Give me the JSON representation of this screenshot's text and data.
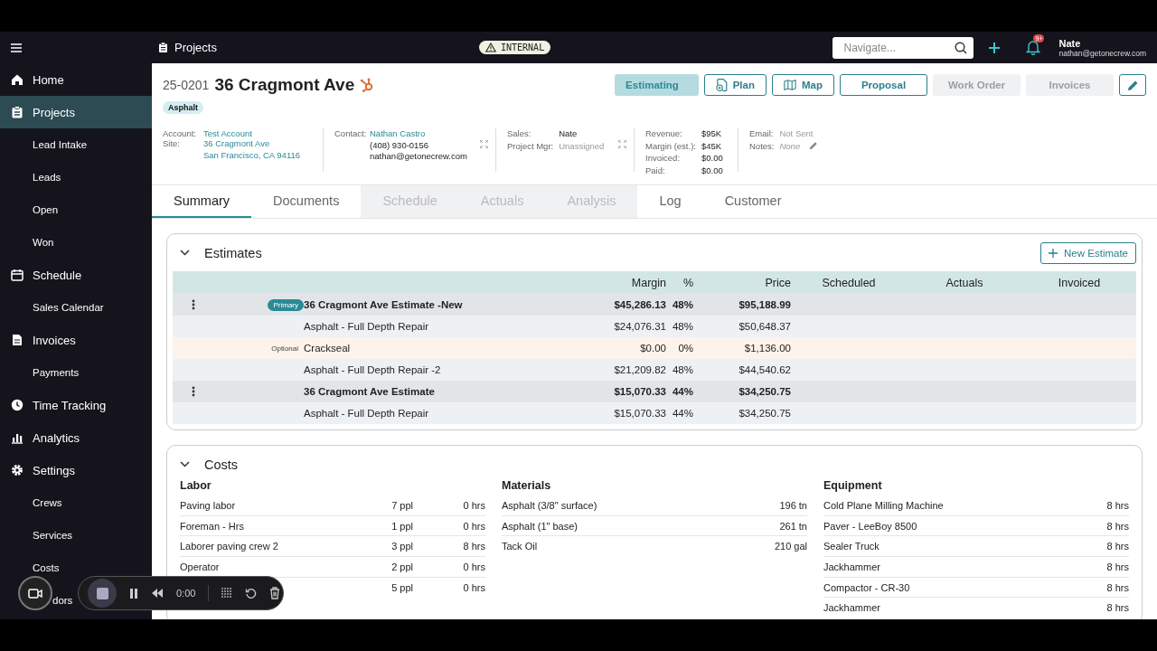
{
  "topbar": {
    "section": "Projects",
    "badge": "INTERNAL",
    "search": {
      "placeholder": "Navigate..."
    },
    "notifications": "9+",
    "user": {
      "name": "Nate",
      "email": "nathan@getonecrew.com"
    }
  },
  "sidebar": {
    "items": [
      {
        "kind": "main",
        "label": "Home",
        "selected": false
      },
      {
        "kind": "main",
        "label": "Projects",
        "selected": true
      },
      {
        "kind": "sub",
        "label": "Lead Intake",
        "selected": false
      },
      {
        "kind": "sub",
        "label": "Leads",
        "selected": false
      },
      {
        "kind": "sub",
        "label": "Open",
        "selected": false
      },
      {
        "kind": "sub",
        "label": "Won",
        "selected": false
      },
      {
        "kind": "main",
        "label": "Schedule",
        "selected": false
      },
      {
        "kind": "sub",
        "label": "Sales Calendar",
        "selected": false
      },
      {
        "kind": "main",
        "label": "Invoices",
        "selected": false
      },
      {
        "kind": "sub",
        "label": "Payments",
        "selected": false
      },
      {
        "kind": "main",
        "label": "Time Tracking",
        "selected": false
      },
      {
        "kind": "main",
        "label": "Analytics",
        "selected": false
      },
      {
        "kind": "main",
        "label": "Settings",
        "selected": false
      },
      {
        "kind": "sub",
        "label": "Crews",
        "selected": false
      },
      {
        "kind": "sub",
        "label": "Services",
        "selected": false
      },
      {
        "kind": "sub",
        "label": "Costs",
        "selected": false
      },
      {
        "kind": "sub",
        "label": "dors",
        "selected": false
      }
    ]
  },
  "project": {
    "number": "25-0201",
    "title": "36 Cragmont Ave",
    "tag": "Asphalt",
    "actions": [
      {
        "kind": "status",
        "label": "Estimating",
        "disabled": false
      },
      {
        "kind": "plan",
        "label": "Plan",
        "disabled": false
      },
      {
        "kind": "map",
        "label": "Map",
        "disabled": false
      },
      {
        "kind": "plain",
        "label": "Proposal",
        "disabled": false
      },
      {
        "kind": "plain",
        "label": "Work Order",
        "disabled": true
      },
      {
        "kind": "plain",
        "label": "Invoices",
        "disabled": true
      },
      {
        "kind": "edit",
        "disabled": false
      }
    ],
    "account": {
      "account_label": "Account:",
      "account": "Test Account",
      "site_label": "Site:",
      "site_line1": "36 Cragmont Ave",
      "site_line2": "San Francisco, CA 94116"
    },
    "contact": {
      "label": "Contact:",
      "name": "Nathan Castro",
      "phone": "(408) 930-0156",
      "email": "nathan@getonecrew.com"
    },
    "people": [
      {
        "label": "Sales:",
        "value": "Nate",
        "unset": false
      },
      {
        "label": "Project Mgr:",
        "value": "Unassigned",
        "unset": true
      }
    ],
    "money": [
      {
        "label": "Revenue:",
        "value": "$95K"
      },
      {
        "label": "Margin (est.):",
        "value": "$45K"
      },
      {
        "label": "Invoiced:",
        "value": "$0.00"
      },
      {
        "label": "Paid:",
        "value": "$0.00"
      }
    ],
    "email_label": "Email:",
    "email_status": "Not Sent",
    "notes_label": "Notes:",
    "notes": "None"
  },
  "tabs": [
    {
      "label": "Summary",
      "selected": true,
      "disabled": false
    },
    {
      "label": "Documents",
      "selected": false,
      "disabled": false
    },
    {
      "label": "Schedule",
      "selected": false,
      "disabled": true
    },
    {
      "label": "Actuals",
      "selected": false,
      "disabled": true
    },
    {
      "label": "Analysis",
      "selected": false,
      "disabled": true
    },
    {
      "label": "Log",
      "selected": false,
      "disabled": false
    },
    {
      "label": "Customer",
      "selected": false,
      "disabled": false
    }
  ],
  "estimates": {
    "title": "Estimates",
    "expanded": true,
    "new_button": "New Estimate",
    "columns": [
      "Margin",
      "%",
      "Price",
      "Scheduled",
      "Actuals",
      "Invoiced"
    ],
    "rows": [
      {
        "kind": "estimate",
        "badge": {
          "kind": "primary",
          "text": "Primary"
        },
        "name": "36 Cragmont Ave Estimate -New",
        "margin": "$45,286.13",
        "pct": "48%",
        "price": "$95,188.99",
        "optional": false
      },
      {
        "kind": "item",
        "name": "Asphalt - Full Depth Repair",
        "margin": "$24,076.31",
        "pct": "48%",
        "price": "$50,648.37",
        "optional": false
      },
      {
        "kind": "item",
        "badge": {
          "kind": "optional",
          "text": "Optional"
        },
        "name": "Crackseal",
        "margin": "$0.00",
        "pct": "0%",
        "price": "$1,136.00",
        "optional": true
      },
      {
        "kind": "item",
        "name": "Asphalt - Full Depth Repair -2",
        "margin": "$21,209.82",
        "pct": "48%",
        "price": "$44,540.62",
        "optional": false
      },
      {
        "kind": "estimate",
        "name": "36 Cragmont Ave Estimate",
        "margin": "$15,070.33",
        "pct": "44%",
        "price": "$34,250.75",
        "optional": false
      },
      {
        "kind": "item",
        "name": "Asphalt - Full Depth Repair",
        "margin": "$15,070.33",
        "pct": "44%",
        "price": "$34,250.75",
        "optional": false
      }
    ]
  },
  "costs": {
    "title": "Costs",
    "expanded": true,
    "labor": {
      "title": "Labor",
      "rows": [
        {
          "name": "Paving labor",
          "people": "7 ppl",
          "hours": "0 hrs"
        },
        {
          "name": "Foreman - Hrs",
          "people": "1 ppl",
          "hours": "0 hrs"
        },
        {
          "name": "Laborer paving crew 2",
          "people": "3 ppl",
          "hours": "8 hrs"
        },
        {
          "name": "Operator",
          "people": "2 ppl",
          "hours": "0 hrs"
        },
        {
          "people": "5 ppl",
          "hours": "0 hrs"
        }
      ]
    },
    "materials": {
      "title": "Materials",
      "rows": [
        {
          "name": "Asphalt (3/8\" surface)",
          "qty": "196 tn"
        },
        {
          "name": "Asphalt (1\" base)",
          "qty": "261 tn"
        },
        {
          "name": "Tack Oil",
          "qty": "210 gal"
        }
      ]
    },
    "equipment": {
      "title": "Equipment",
      "rows": [
        {
          "name": "Cold Plane Milling Machine",
          "hours": "8 hrs"
        },
        {
          "name": "Paver - LeeBoy 8500",
          "hours": "8 hrs"
        },
        {
          "name": "Sealer Truck",
          "hours": "8 hrs"
        },
        {
          "name": "Jackhammer",
          "hours": "8 hrs"
        },
        {
          "name": "Compactor - CR-30",
          "hours": "8 hrs"
        },
        {
          "name": "Jackhammer",
          "hours": "8 hrs"
        }
      ]
    }
  },
  "recorder": {
    "time": "0:00",
    "paused": false
  }
}
